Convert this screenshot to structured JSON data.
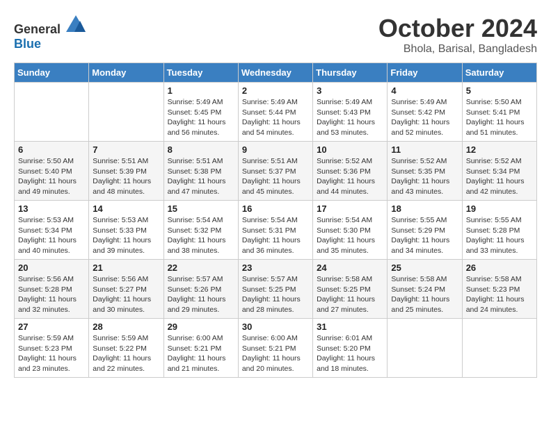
{
  "header": {
    "logo_general": "General",
    "logo_blue": "Blue",
    "month_title": "October 2024",
    "location": "Bhola, Barisal, Bangladesh"
  },
  "days_of_week": [
    "Sunday",
    "Monday",
    "Tuesday",
    "Wednesday",
    "Thursday",
    "Friday",
    "Saturday"
  ],
  "weeks": [
    [
      {
        "day": "",
        "info": ""
      },
      {
        "day": "",
        "info": ""
      },
      {
        "day": "1",
        "info": "Sunrise: 5:49 AM\nSunset: 5:45 PM\nDaylight: 11 hours and 56 minutes."
      },
      {
        "day": "2",
        "info": "Sunrise: 5:49 AM\nSunset: 5:44 PM\nDaylight: 11 hours and 54 minutes."
      },
      {
        "day": "3",
        "info": "Sunrise: 5:49 AM\nSunset: 5:43 PM\nDaylight: 11 hours and 53 minutes."
      },
      {
        "day": "4",
        "info": "Sunrise: 5:49 AM\nSunset: 5:42 PM\nDaylight: 11 hours and 52 minutes."
      },
      {
        "day": "5",
        "info": "Sunrise: 5:50 AM\nSunset: 5:41 PM\nDaylight: 11 hours and 51 minutes."
      }
    ],
    [
      {
        "day": "6",
        "info": "Sunrise: 5:50 AM\nSunset: 5:40 PM\nDaylight: 11 hours and 49 minutes."
      },
      {
        "day": "7",
        "info": "Sunrise: 5:51 AM\nSunset: 5:39 PM\nDaylight: 11 hours and 48 minutes."
      },
      {
        "day": "8",
        "info": "Sunrise: 5:51 AM\nSunset: 5:38 PM\nDaylight: 11 hours and 47 minutes."
      },
      {
        "day": "9",
        "info": "Sunrise: 5:51 AM\nSunset: 5:37 PM\nDaylight: 11 hours and 45 minutes."
      },
      {
        "day": "10",
        "info": "Sunrise: 5:52 AM\nSunset: 5:36 PM\nDaylight: 11 hours and 44 minutes."
      },
      {
        "day": "11",
        "info": "Sunrise: 5:52 AM\nSunset: 5:35 PM\nDaylight: 11 hours and 43 minutes."
      },
      {
        "day": "12",
        "info": "Sunrise: 5:52 AM\nSunset: 5:34 PM\nDaylight: 11 hours and 42 minutes."
      }
    ],
    [
      {
        "day": "13",
        "info": "Sunrise: 5:53 AM\nSunset: 5:34 PM\nDaylight: 11 hours and 40 minutes."
      },
      {
        "day": "14",
        "info": "Sunrise: 5:53 AM\nSunset: 5:33 PM\nDaylight: 11 hours and 39 minutes."
      },
      {
        "day": "15",
        "info": "Sunrise: 5:54 AM\nSunset: 5:32 PM\nDaylight: 11 hours and 38 minutes."
      },
      {
        "day": "16",
        "info": "Sunrise: 5:54 AM\nSunset: 5:31 PM\nDaylight: 11 hours and 36 minutes."
      },
      {
        "day": "17",
        "info": "Sunrise: 5:54 AM\nSunset: 5:30 PM\nDaylight: 11 hours and 35 minutes."
      },
      {
        "day": "18",
        "info": "Sunrise: 5:55 AM\nSunset: 5:29 PM\nDaylight: 11 hours and 34 minutes."
      },
      {
        "day": "19",
        "info": "Sunrise: 5:55 AM\nSunset: 5:28 PM\nDaylight: 11 hours and 33 minutes."
      }
    ],
    [
      {
        "day": "20",
        "info": "Sunrise: 5:56 AM\nSunset: 5:28 PM\nDaylight: 11 hours and 32 minutes."
      },
      {
        "day": "21",
        "info": "Sunrise: 5:56 AM\nSunset: 5:27 PM\nDaylight: 11 hours and 30 minutes."
      },
      {
        "day": "22",
        "info": "Sunrise: 5:57 AM\nSunset: 5:26 PM\nDaylight: 11 hours and 29 minutes."
      },
      {
        "day": "23",
        "info": "Sunrise: 5:57 AM\nSunset: 5:25 PM\nDaylight: 11 hours and 28 minutes."
      },
      {
        "day": "24",
        "info": "Sunrise: 5:58 AM\nSunset: 5:25 PM\nDaylight: 11 hours and 27 minutes."
      },
      {
        "day": "25",
        "info": "Sunrise: 5:58 AM\nSunset: 5:24 PM\nDaylight: 11 hours and 25 minutes."
      },
      {
        "day": "26",
        "info": "Sunrise: 5:58 AM\nSunset: 5:23 PM\nDaylight: 11 hours and 24 minutes."
      }
    ],
    [
      {
        "day": "27",
        "info": "Sunrise: 5:59 AM\nSunset: 5:23 PM\nDaylight: 11 hours and 23 minutes."
      },
      {
        "day": "28",
        "info": "Sunrise: 5:59 AM\nSunset: 5:22 PM\nDaylight: 11 hours and 22 minutes."
      },
      {
        "day": "29",
        "info": "Sunrise: 6:00 AM\nSunset: 5:21 PM\nDaylight: 11 hours and 21 minutes."
      },
      {
        "day": "30",
        "info": "Sunrise: 6:00 AM\nSunset: 5:21 PM\nDaylight: 11 hours and 20 minutes."
      },
      {
        "day": "31",
        "info": "Sunrise: 6:01 AM\nSunset: 5:20 PM\nDaylight: 11 hours and 18 minutes."
      },
      {
        "day": "",
        "info": ""
      },
      {
        "day": "",
        "info": ""
      }
    ]
  ]
}
